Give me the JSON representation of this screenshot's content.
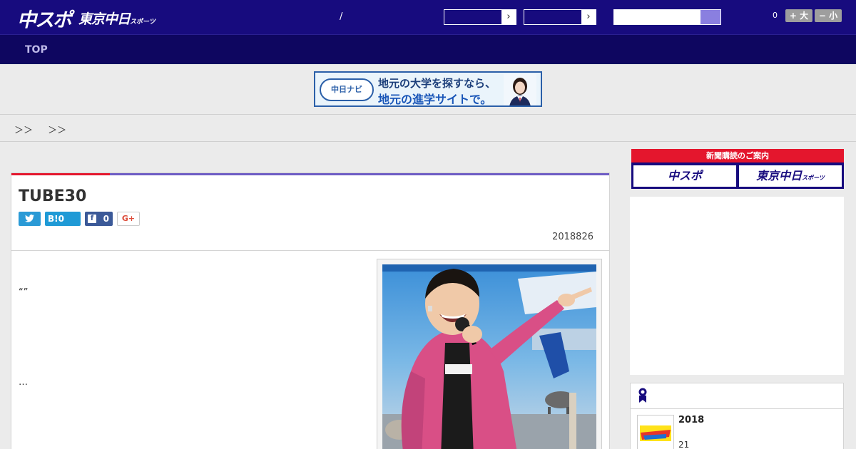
{
  "header": {
    "logo_main": "中スポ",
    "logo_sub": "東京中日",
    "logo_sub_small": "スポーツ",
    "slash": "/",
    "select_arrow": "›",
    "font_count": "0",
    "font_larger": "+ 大",
    "font_smaller": "− 小"
  },
  "nav": {
    "top": "TOP"
  },
  "banner": {
    "badge": "中日ナビ",
    "line1": "地元の大学を探すなら、",
    "line2": "地元の進学サイトで。"
  },
  "breadcrumb": "＞＞　 ＞＞",
  "article": {
    "title": "TUBE30",
    "twitter_icon": "twitter-bird",
    "hatena_label": "B!0",
    "facebook_icon_glyph": "f",
    "facebook_count": "0",
    "gplus_label": "G+",
    "date": "2018826",
    "paragraph1": "“”",
    "paragraph2": "…"
  },
  "sidebar": {
    "subscribe_header": "新聞購読のご案内",
    "subscribe_btn1": "中スポ",
    "subscribe_btn2": "東京中日",
    "subscribe_btn2_small": "スポーツ",
    "ranking_item_title": "2018",
    "ranking_item_sub": "21"
  },
  "colors": {
    "header_bg": "#170b7e",
    "nav_bg": "#0e0660",
    "accent_red": "#e4162d",
    "accent_purple": "#6e5cc4"
  }
}
